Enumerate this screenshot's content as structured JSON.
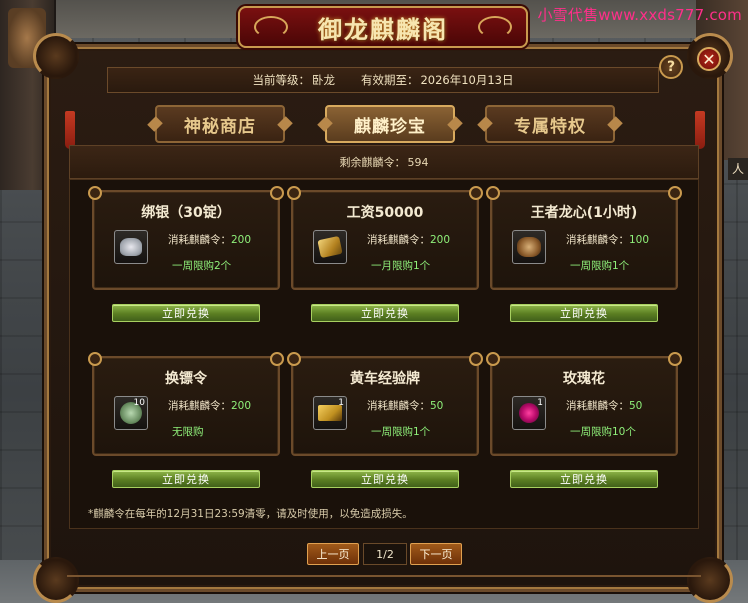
{
  "watermark": "小雪代售www.xxds777.com",
  "background": {
    "npc_label": "人"
  },
  "window": {
    "title": "御龙麒麟阁",
    "help_label": "?",
    "close_label": "✕",
    "info": {
      "level_label": "当前等级：",
      "level_value": "卧龙",
      "expiry_label": "有效期至：",
      "expiry_value": "2026年10月13日"
    },
    "tabs": [
      {
        "label": "神秘商店",
        "active": false
      },
      {
        "label": "麒麟珍宝",
        "active": true
      },
      {
        "label": "专属特权",
        "active": false
      }
    ],
    "remaining": {
      "label": "剩余麒麟令：",
      "value": "594"
    },
    "items": [
      {
        "name": "绑银（30锭）",
        "icon": "silver-ingot-icon",
        "count": "",
        "cost_label": "消耗麒麟令：",
        "cost": "200",
        "limit": "一周限购2个"
      },
      {
        "name": "工资50000",
        "icon": "gold-scroll-icon",
        "count": "",
        "cost_label": "消耗麒麟令：",
        "cost": "200",
        "limit": "一月限购1个"
      },
      {
        "name": "王者龙心(1小时)",
        "icon": "dragon-heart-icon",
        "count": "",
        "cost_label": "消耗麒麟令：",
        "cost": "100",
        "limit": "一周限购1个"
      },
      {
        "name": "换镖令",
        "icon": "jade-token-icon",
        "count": "10",
        "cost_label": "消耗麒麟令：",
        "cost": "200",
        "limit": "无限购"
      },
      {
        "name": "黄车经验牌",
        "icon": "yellow-cart-icon",
        "count": "1",
        "cost_label": "消耗麒麟令：",
        "cost": "50",
        "limit": "一周限购1个"
      },
      {
        "name": "玫瑰花",
        "icon": "rose-icon",
        "count": "1",
        "cost_label": "消耗麒麟令：",
        "cost": "50",
        "limit": "一周限购10个"
      }
    ],
    "redeem_label": "立即兑换",
    "notice": "*麒麟令在每年的12月31日23:59清零，请及时使用，以免造成损失。",
    "pager": {
      "prev_label": "上一页",
      "next_label": "下一页",
      "current": "1/2"
    }
  }
}
